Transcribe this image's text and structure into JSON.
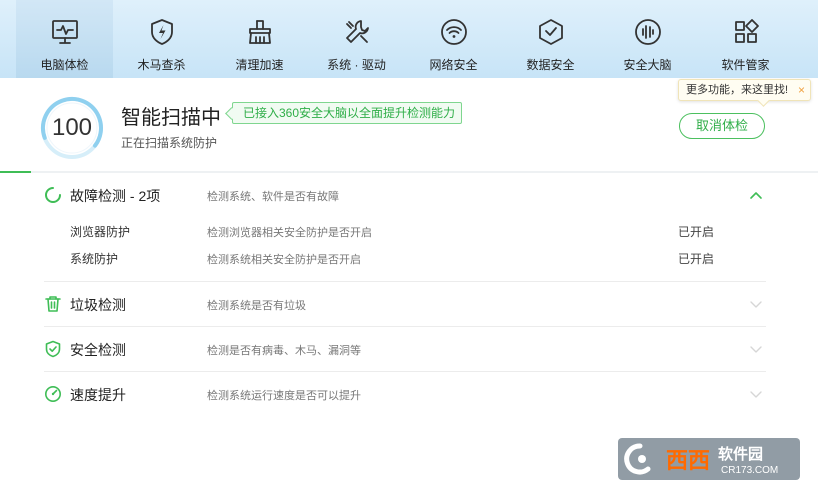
{
  "nav": {
    "items": [
      {
        "label": "电脑体检",
        "icon": "monitor-pulse-icon"
      },
      {
        "label": "木马查杀",
        "icon": "shield-bolt-icon"
      },
      {
        "label": "清理加速",
        "icon": "broom-icon"
      },
      {
        "label": "系统 · 驱动",
        "icon": "wrench-screwdriver-icon"
      },
      {
        "label": "网络安全",
        "icon": "wifi-icon"
      },
      {
        "label": "数据安全",
        "icon": "box-check-icon"
      },
      {
        "label": "安全大脑",
        "icon": "brain-icon"
      },
      {
        "label": "软件管家",
        "icon": "apps-grid-icon"
      }
    ],
    "active_index": 0
  },
  "header": {
    "score": "100",
    "title": "智能扫描中",
    "subtitle": "正在扫描系统防护",
    "badge": "已接入360安全大脑以全面提升检测能力",
    "cancel_label": "取消体检",
    "tooltip": "更多功能，来这里找!",
    "tooltip_close": "×",
    "progress": 0.038
  },
  "checks": {
    "fault": {
      "title": "故障检测 - 2项",
      "desc": "检测系统、软件是否有故障",
      "expanded": true,
      "items": [
        {
          "name": "浏览器防护",
          "desc": "检测浏览器相关安全防护是否开启",
          "status": "已开启"
        },
        {
          "name": "系统防护",
          "desc": "检测系统相关安全防护是否开启",
          "status": "已开启"
        }
      ]
    },
    "junk": {
      "title": "垃圾检测",
      "desc": "检测系统是否有垃圾"
    },
    "security": {
      "title": "安全检测",
      "desc": "检测是否有病毒、木马、漏洞等"
    },
    "speed": {
      "title": "速度提升",
      "desc": "检测系统运行速度是否可以提升"
    }
  },
  "watermark": {
    "brand": "西西",
    "brand_suffix": "软件园",
    "domain": "CR173.COM"
  },
  "colors": {
    "accent_green": "#2fae48",
    "nav_bg": "#c7e4f7",
    "ring_blue": "#8fd0ef"
  }
}
